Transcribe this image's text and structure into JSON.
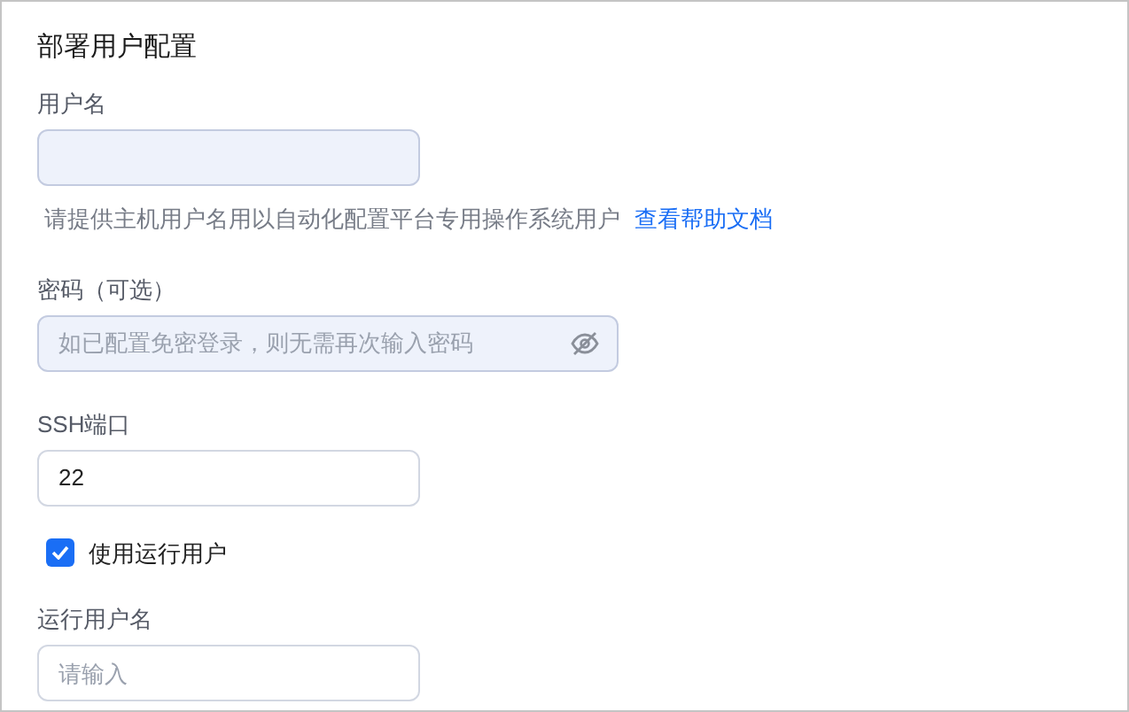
{
  "title": "部署用户配置",
  "fields": [
    {
      "kind": "text",
      "label": "用户名",
      "disabled": true,
      "help": {
        "text": "请提供主机用户名用以自动化配置平台专用操作系统用户",
        "link": "查看帮助文档"
      }
    },
    {
      "kind": "password",
      "label": "密码（可选）",
      "placeholder": "如已配置免密登录，则无需再次输入密码",
      "disabled": true
    },
    {
      "kind": "text",
      "label": "SSH端口",
      "value": "22",
      "disabled": false
    },
    {
      "kind": "checkbox",
      "label": "使用运行用户",
      "checked": true
    },
    {
      "kind": "text",
      "label": "运行用户名",
      "placeholder": "请输入",
      "disabled": false
    }
  ]
}
